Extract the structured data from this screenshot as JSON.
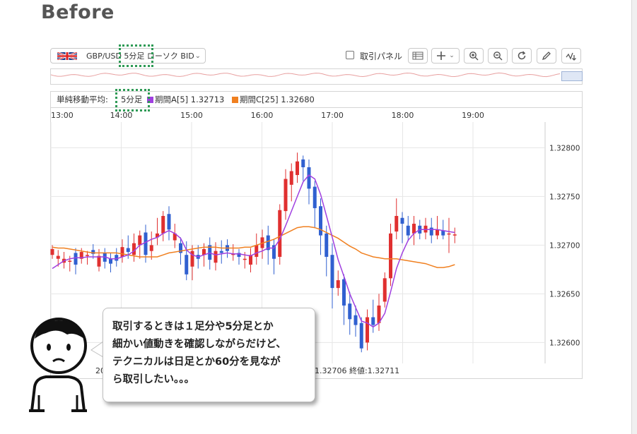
{
  "heading": "Before",
  "toolbar": {
    "symbol_label": "GBP/USD 5分足 ローソク BID",
    "panel_label": "取引パネル",
    "icons": [
      "flag-uk-icon",
      "chevron-down-icon",
      "table-icon",
      "crosshair-icon",
      "chevron-down-icon",
      "zoom-in-icon",
      "zoom-out-icon",
      "refresh-icon",
      "pencil-icon",
      "indicator-icon"
    ]
  },
  "legend": {
    "label": "単純移動平均:",
    "timeframe": "5分足",
    "periodA": "期間A[5] 1.32713",
    "periodC": "期間C[25] 1.32680",
    "colorA": "#a040e0",
    "colorC": "#f08020"
  },
  "status_line": {
    "date_fragment": "2025/",
    "values": "1.32706  終値:1.32711"
  },
  "bubble": {
    "text": "取引するときは１足分や5分足とか\n細かい値動きを確認しながらだけど、\nテクニカルは日足とか60分を見なが\nら取引したい。。。"
  },
  "colors": {
    "up": "#e03030",
    "down": "#3060d0",
    "smaA": "#a040e0",
    "smaC": "#f08020",
    "highlight": "#2e9a55"
  },
  "chart_data": {
    "type": "candlestick",
    "symbol": "GBP/USD",
    "x_ticks": [
      "13:00",
      "14:00",
      "15:00",
      "16:00",
      "17:00",
      "18:00",
      "19:00"
    ],
    "y_ticks": [
      "1.32600",
      "1.32650",
      "1.32700",
      "1.32750",
      "1.32800"
    ],
    "ylim": [
      1.3258,
      1.3283
    ],
    "grid": true,
    "candles": [
      [
        1.3269,
        1.32696,
        1.327,
        1.32686
      ],
      [
        1.32686,
        1.32689,
        1.32695,
        1.32678
      ],
      [
        1.32682,
        1.32686,
        1.32693,
        1.32676
      ],
      [
        1.32684,
        1.32684,
        1.32689,
        1.32673
      ],
      [
        1.32692,
        1.3268,
        1.32697,
        1.3267
      ],
      [
        1.32686,
        1.32693,
        1.32697,
        1.32681
      ],
      [
        1.3269,
        1.3269,
        1.32694,
        1.3268
      ],
      [
        1.32695,
        1.32691,
        1.32701,
        1.32686
      ],
      [
        1.32678,
        1.32689,
        1.32696,
        1.32673
      ],
      [
        1.32692,
        1.32683,
        1.32697,
        1.32676
      ],
      [
        1.32686,
        1.32681,
        1.32692,
        1.32672
      ],
      [
        1.3269,
        1.32684,
        1.32697,
        1.32678
      ],
      [
        1.32688,
        1.32698,
        1.32706,
        1.32682
      ],
      [
        1.32697,
        1.32693,
        1.3271,
        1.32686
      ],
      [
        1.3269,
        1.32702,
        1.32712,
        1.32683
      ],
      [
        1.327,
        1.3271,
        1.32715,
        1.32686
      ],
      [
        1.32713,
        1.3269,
        1.32721,
        1.32682
      ],
      [
        1.32694,
        1.327,
        1.32714,
        1.32685
      ],
      [
        1.32708,
        1.32712,
        1.32728,
        1.327
      ],
      [
        1.32712,
        1.3273,
        1.32735,
        1.32704
      ],
      [
        1.32732,
        1.32716,
        1.3274,
        1.32705
      ],
      [
        1.32705,
        1.32712,
        1.32722,
        1.32697
      ],
      [
        1.32702,
        1.32692,
        1.32708,
        1.3268
      ],
      [
        1.3269,
        1.3267,
        1.32704,
        1.32664
      ],
      [
        1.32678,
        1.32694,
        1.327,
        1.32664
      ],
      [
        1.3269,
        1.32686,
        1.327,
        1.32676
      ],
      [
        1.3269,
        1.32696,
        1.32702,
        1.32678
      ],
      [
        1.327,
        1.32685,
        1.32708,
        1.32675
      ],
      [
        1.32682,
        1.32694,
        1.32703,
        1.32674
      ],
      [
        1.32694,
        1.32692,
        1.32705,
        1.32681
      ],
      [
        1.327,
        1.32694,
        1.32706,
        1.32687
      ],
      [
        1.32691,
        1.32691,
        1.32701,
        1.32684
      ],
      [
        1.32692,
        1.32688,
        1.32696,
        1.3268
      ],
      [
        1.32686,
        1.32686,
        1.32693,
        1.32676
      ],
      [
        1.3268,
        1.3269,
        1.32697,
        1.32672
      ],
      [
        1.32688,
        1.327,
        1.32712,
        1.3268
      ],
      [
        1.32697,
        1.32708,
        1.32716,
        1.32686
      ],
      [
        1.3271,
        1.32695,
        1.3272,
        1.3268
      ],
      [
        1.327,
        1.32686,
        1.32706,
        1.3267
      ],
      [
        1.32688,
        1.32736,
        1.32742,
        1.3268
      ],
      [
        1.32735,
        1.32768,
        1.32778,
        1.32726
      ],
      [
        1.32762,
        1.32776,
        1.32784,
        1.32745
      ],
      [
        1.32772,
        1.32786,
        1.32795,
        1.32764
      ],
      [
        1.32788,
        1.3278,
        1.32792,
        1.32766
      ],
      [
        1.3278,
        1.32758,
        1.32788,
        1.32742
      ],
      [
        1.3276,
        1.32738,
        1.32766,
        1.32718
      ],
      [
        1.3274,
        1.3271,
        1.32748,
        1.3269
      ],
      [
        1.32712,
        1.32688,
        1.3272,
        1.32668
      ],
      [
        1.3269,
        1.32656,
        1.32702,
        1.32635
      ],
      [
        1.32656,
        1.32664,
        1.32674,
        1.32648
      ],
      [
        1.32665,
        1.32638,
        1.3267,
        1.32618
      ],
      [
        1.3264,
        1.32624,
        1.32652,
        1.32608
      ],
      [
        1.32628,
        1.32618,
        1.32638,
        1.32606
      ],
      [
        1.3262,
        1.32594,
        1.32626,
        1.3259
      ],
      [
        1.326,
        1.32626,
        1.32634,
        1.32592
      ],
      [
        1.32626,
        1.32618,
        1.32644,
        1.3261
      ],
      [
        1.3262,
        1.32638,
        1.3265,
        1.32612
      ],
      [
        1.32642,
        1.32666,
        1.32672,
        1.32636
      ],
      [
        1.32666,
        1.32712,
        1.32722,
        1.32658
      ],
      [
        1.32714,
        1.3273,
        1.32748,
        1.32706
      ],
      [
        1.32728,
        1.32722,
        1.32734,
        1.32702
      ],
      [
        1.3272,
        1.3271,
        1.3273,
        1.32704
      ],
      [
        1.32712,
        1.32722,
        1.3273,
        1.327
      ],
      [
        1.3272,
        1.32712,
        1.32726,
        1.32706
      ],
      [
        1.32713,
        1.3272,
        1.32728,
        1.32706
      ],
      [
        1.32718,
        1.3271,
        1.32728,
        1.32702
      ],
      [
        1.3271,
        1.32716,
        1.3273,
        1.32706
      ],
      [
        1.32715,
        1.3271,
        1.32726,
        1.32706
      ],
      [
        1.32712,
        1.32712,
        1.32728,
        1.32692
      ],
      [
        1.3271,
        1.32711,
        1.32718,
        1.32702
      ]
    ],
    "series": [
      {
        "name": "期間A[5]",
        "values": [
          1.32676,
          1.3268,
          1.32684,
          1.32686,
          1.32687,
          1.32687,
          1.32688,
          1.32688,
          1.32688,
          1.32688,
          1.32686,
          1.32686,
          1.32688,
          1.3269,
          1.32694,
          1.327,
          1.32703,
          1.32706,
          1.32708,
          1.32712,
          1.32715,
          1.32712,
          1.32707,
          1.32695,
          1.3269,
          1.32688,
          1.3269,
          1.32692,
          1.3269,
          1.32691,
          1.32692,
          1.32691,
          1.32691,
          1.3269,
          1.32689,
          1.32692,
          1.32694,
          1.32697,
          1.32697,
          1.32706,
          1.3272,
          1.32735,
          1.3275,
          1.32765,
          1.32772,
          1.32768,
          1.32752,
          1.3273,
          1.32708,
          1.32685,
          1.32668,
          1.3265,
          1.32636,
          1.32622,
          1.3262,
          1.32616,
          1.3262,
          1.3263,
          1.32652,
          1.32676,
          1.32692,
          1.32705,
          1.32712,
          1.32716,
          1.32716,
          1.32716,
          1.32716,
          1.32715,
          1.32714,
          1.32713
        ]
      },
      {
        "name": "期間C[25]",
        "values": [
          1.32698,
          1.32697,
          1.32697,
          1.32696,
          1.32695,
          1.32694,
          1.32693,
          1.32692,
          1.32692,
          1.32692,
          1.32692,
          1.32692,
          1.32691,
          1.3269,
          1.32689,
          1.32688,
          1.32688,
          1.32688,
          1.32688,
          1.3269,
          1.32692,
          1.32693,
          1.32694,
          1.32695,
          1.32696,
          1.32697,
          1.32698,
          1.32698,
          1.32698,
          1.32697,
          1.32697,
          1.32697,
          1.32697,
          1.32698,
          1.32698,
          1.327,
          1.32702,
          1.32704,
          1.32706,
          1.32709,
          1.32712,
          1.32715,
          1.32718,
          1.32719,
          1.32719,
          1.32718,
          1.32716,
          1.32713,
          1.3271,
          1.32707,
          1.32703,
          1.32699,
          1.32696,
          1.32692,
          1.3269,
          1.32688,
          1.32687,
          1.32686,
          1.32686,
          1.32686,
          1.32685,
          1.32684,
          1.32683,
          1.32682,
          1.32681,
          1.32679,
          1.32677,
          1.32677,
          1.32678,
          1.3268
        ]
      }
    ]
  }
}
